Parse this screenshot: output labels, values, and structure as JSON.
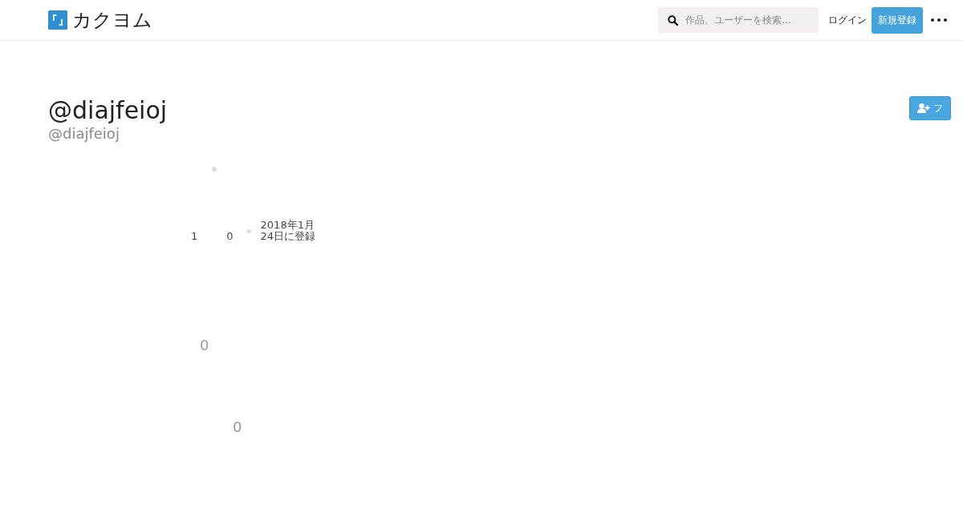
{
  "header": {
    "logo_text": "カクヨム",
    "search": {
      "placeholder": "作品、ユーザーを検索…"
    },
    "login_link": "ログイン",
    "signup_button": "新規登録"
  },
  "profile": {
    "name": "@diajfeioj",
    "handle": "@diajfeioj",
    "follow_button": "フ"
  },
  "stats": [
    {
      "value": "1"
    },
    {
      "value": "0"
    }
  ],
  "joined": "2018年1月24日に登録",
  "counters": [
    {
      "value": "0"
    },
    {
      "value": "0"
    }
  ]
}
